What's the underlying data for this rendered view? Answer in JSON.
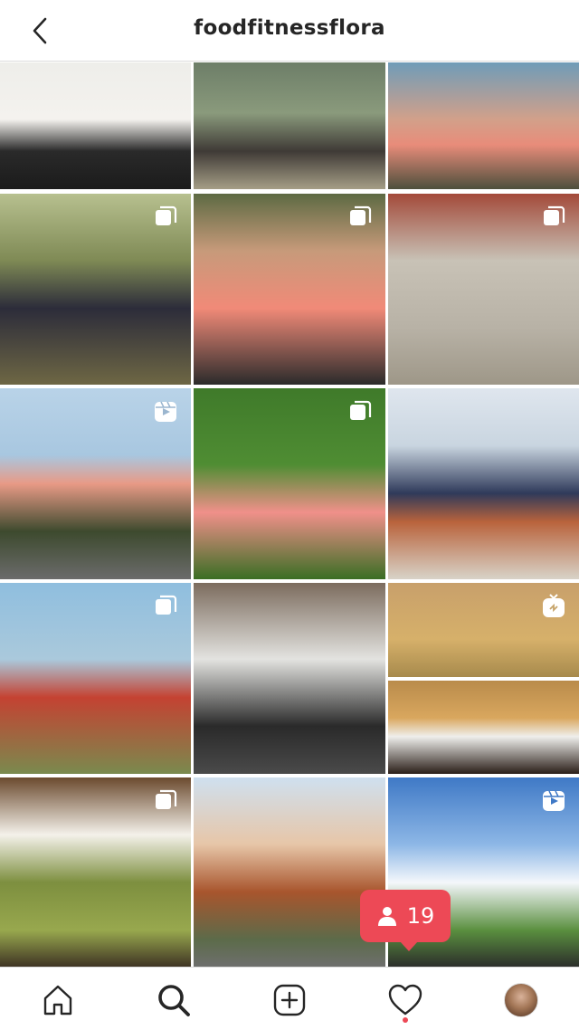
{
  "header": {
    "username": "foodfitnessflora"
  },
  "grid": {
    "tiles": [
      {
        "badge": null
      },
      {
        "badge": null
      },
      {
        "badge": null
      },
      {
        "badge": "carousel-icon"
      },
      {
        "badge": "carousel-icon"
      },
      {
        "badge": "carousel-icon"
      },
      {
        "badge": "reels-icon"
      },
      {
        "badge": "carousel-icon"
      },
      {
        "badge": null
      },
      {
        "badge": "carousel-icon"
      },
      {
        "badge": null
      },
      {
        "badge": "igtv-icon"
      },
      {
        "badge": "carousel-icon"
      },
      {
        "badge": null
      },
      {
        "badge": "reels-icon"
      }
    ]
  },
  "activity": {
    "follower_count": "19"
  },
  "tabbar": {
    "items": [
      "home-icon",
      "search-icon",
      "new-post-icon",
      "activity-heart-icon",
      "profile-avatar"
    ]
  },
  "colors": {
    "activity_badge": "#ed4956",
    "text": "#262626"
  }
}
